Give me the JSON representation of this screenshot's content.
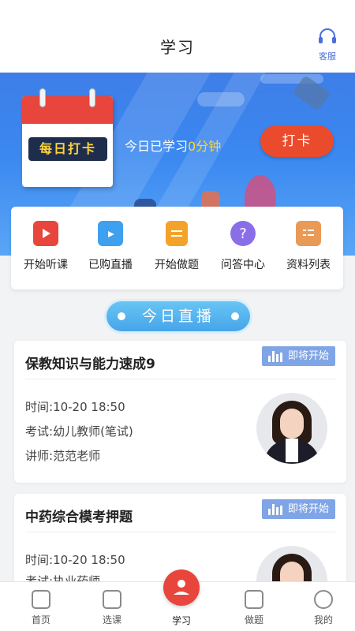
{
  "header": {
    "title": "学习",
    "service_label": "客服"
  },
  "banner": {
    "calendar_label": "每日打卡",
    "study_prefix": "今日已学习",
    "study_value": "0分钟",
    "checkin_label": "打卡"
  },
  "menu": {
    "items": [
      {
        "label": "开始听课",
        "icon": "video-play-icon",
        "color": "#e8453c"
      },
      {
        "label": "已购直播",
        "icon": "tv-icon",
        "color": "#3ea0ee"
      },
      {
        "label": "开始做题",
        "icon": "document-icon",
        "color": "#f4a32a"
      },
      {
        "label": "问答中心",
        "icon": "question-icon",
        "color": "#8a6ee8"
      },
      {
        "label": "资料列表",
        "icon": "list-icon",
        "color": "#e99a56"
      }
    ]
  },
  "section": {
    "title": "今日直播"
  },
  "live": [
    {
      "title": "保教知识与能力速成9",
      "status": "即将开始",
      "time_label": "时间:",
      "time": "10-20 18:50",
      "exam_label": "考试:",
      "exam": "幼儿教师(笔试)",
      "teacher_label": "讲师:",
      "teacher": "范范老师"
    },
    {
      "title": "中药综合模考押题",
      "status": "即将开始",
      "time_label": "时间:",
      "time": "10-20 18:50",
      "exam_label": "考试:",
      "exam": "执业药师"
    }
  ],
  "tabs": [
    {
      "label": "首页",
      "icon": "home-icon"
    },
    {
      "label": "选课",
      "icon": "bag-icon"
    },
    {
      "label": "学习",
      "icon": "study-icon"
    },
    {
      "label": "做题",
      "icon": "exam-icon"
    },
    {
      "label": "我的",
      "icon": "profile-icon"
    }
  ],
  "colors": {
    "accent": "#e8463c",
    "primary": "#3f7ee8",
    "badge": "#7fa5e6"
  }
}
